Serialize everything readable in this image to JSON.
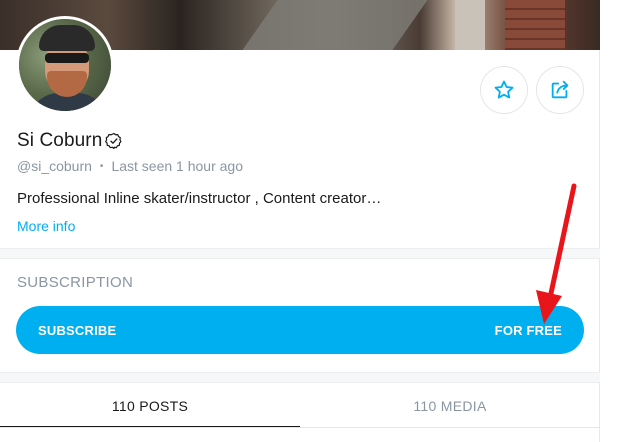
{
  "profile": {
    "name": "Si Coburn",
    "handle": "@si_coburn",
    "separator": "•",
    "last_seen": "Last seen 1 hour ago",
    "bio": "Professional Inline skater/instructor , Content creator…",
    "more_info": "More info"
  },
  "actions": {
    "favorite_icon": "star-icon",
    "share_icon": "share-icon"
  },
  "subscription": {
    "title": "SUBSCRIPTION",
    "button_label": "SUBSCRIBE",
    "button_price": "FOR FREE"
  },
  "tabs": [
    {
      "label": "110 POSTS",
      "active": true
    },
    {
      "label": "110 MEDIA",
      "active": false
    }
  ],
  "colors": {
    "accent": "#00aff0",
    "annotation": "#e8151b",
    "muted_text": "#8a96a3"
  }
}
